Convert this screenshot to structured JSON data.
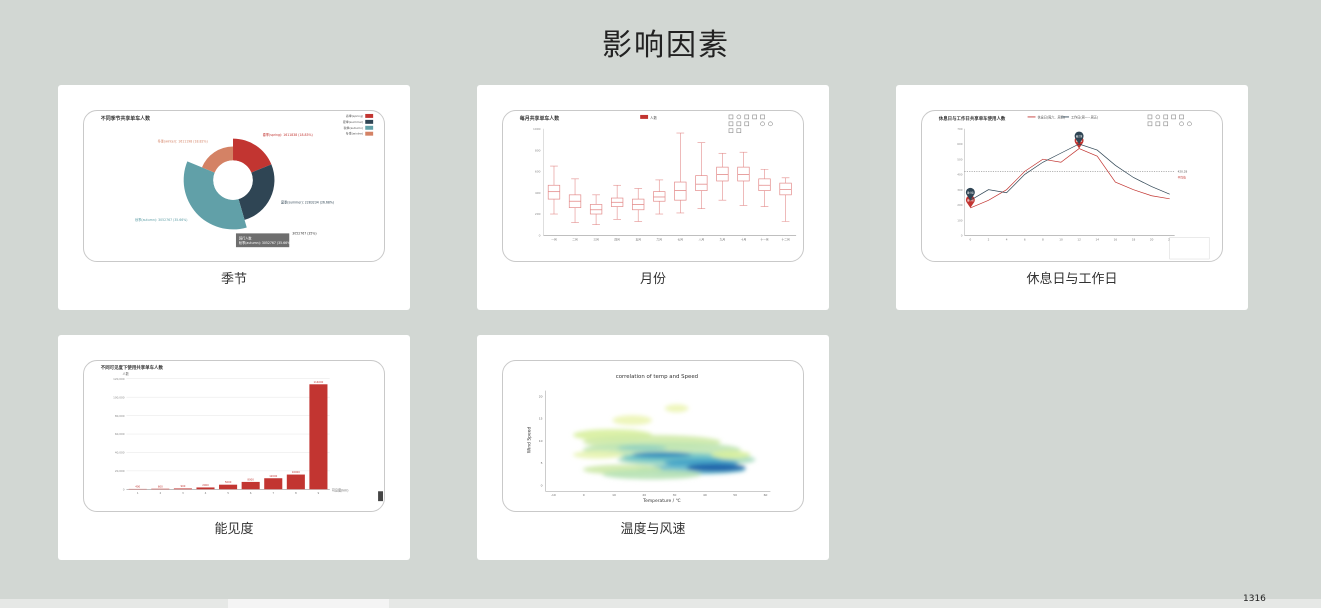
{
  "page": {
    "title": "影响因素"
  },
  "cards": [
    {
      "label": "季节",
      "chart_data": {
        "type": "pie",
        "title": "不同季节共享单车人数",
        "legend": [
          "春季(spring)",
          "夏季(summer)",
          "秋季(autumn)",
          "冬季(winter)"
        ],
        "values": [
          1611838,
          2283234,
          3052767,
          1611198
        ],
        "colors": [
          "#c23531",
          "#2f4554",
          "#61a0a8",
          "#d48265"
        ],
        "slice_labels": [
          "春季(spring): 1611838 (18.83%)",
          "夏季(summer): 2283234 (26.68%)",
          "秋季(autumn): 3052767 (35.66%)",
          "冬季(winter): 1611198 (18.82%)"
        ],
        "tooltip": "秋季(autumn): 3052767 (35.66%)",
        "tooltip_title": "骑行人数",
        "callout": "3052767 (35%)"
      }
    },
    {
      "label": "月份",
      "chart_data": {
        "type": "boxplot",
        "title": "每月共享单车人数",
        "legend": [
          "人数"
        ],
        "categories": [
          "一月",
          "二月",
          "三月",
          "四月",
          "五月",
          "六月",
          "七月",
          "八月",
          "九月",
          "十月",
          "十一月",
          "十二月"
        ],
        "ylim": [
          0,
          1000
        ],
        "box": [
          {
            "min": 200,
            "q1": 340,
            "median": 410,
            "q3": 470,
            "max": 650
          },
          {
            "min": 120,
            "q1": 260,
            "median": 320,
            "q3": 380,
            "max": 530
          },
          {
            "min": 100,
            "q1": 200,
            "median": 240,
            "q3": 290,
            "max": 380
          },
          {
            "min": 150,
            "q1": 270,
            "median": 310,
            "q3": 350,
            "max": 470
          },
          {
            "min": 130,
            "q1": 240,
            "median": 290,
            "q3": 340,
            "max": 440
          },
          {
            "min": 200,
            "q1": 320,
            "median": 360,
            "q3": 410,
            "max": 520
          },
          {
            "min": 210,
            "q1": 330,
            "median": 420,
            "q3": 500,
            "max": 960
          },
          {
            "min": 250,
            "q1": 420,
            "median": 480,
            "q3": 560,
            "max": 870
          },
          {
            "min": 330,
            "q1": 510,
            "median": 570,
            "q3": 640,
            "max": 770
          },
          {
            "min": 280,
            "q1": 510,
            "median": 570,
            "q3": 640,
            "max": 780
          },
          {
            "min": 270,
            "q1": 420,
            "median": 470,
            "q3": 530,
            "max": 620
          },
          {
            "min": 130,
            "q1": 380,
            "median": 430,
            "q3": 490,
            "max": 540
          }
        ]
      }
    },
    {
      "label": "休息日与工作日",
      "chart_data": {
        "type": "line",
        "title": "休息日与工作日共享单车使用人数",
        "legend": [
          "休息日(周六、周日)",
          "工作日(周一~周五)"
        ],
        "categories": [
          "0",
          "2",
          "4",
          "6",
          "8",
          "10",
          "12",
          "14",
          "16",
          "18",
          "20",
          "22"
        ],
        "ylim": [
          0,
          700
        ],
        "series": [
          {
            "name": "休息日(周六、周日)",
            "color": "#c23531",
            "values": [
              180,
              230,
              300,
              420,
              500,
              480,
              570,
              520,
              350,
              300,
              260,
              240
            ]
          },
          {
            "name": "工作日(周一~周五)",
            "color": "#2f4554",
            "values": [
              230,
              300,
              280,
              400,
              480,
              540,
              600,
              560,
              460,
              380,
              320,
              270
            ]
          }
        ],
        "avg_line": 420,
        "avg_labels": [
          "420.28",
          "平均值"
        ],
        "markers": [
          "最大值",
          "最小值",
          "最大值",
          "最小值"
        ]
      }
    },
    {
      "label": "能见度",
      "chart_data": {
        "type": "bar",
        "title": "不同可见度下使用共享单车人数",
        "xlabel": "可见度(km)",
        "ylabel": "人数",
        "categories": [
          "1",
          "2",
          "3",
          "4",
          "5",
          "6",
          "7",
          "8",
          "9"
        ],
        "values": [
          400,
          600,
          900,
          2000,
          5000,
          8000,
          12000,
          16000,
          114000
        ],
        "ylim": [
          0,
          120000
        ],
        "yticks": [
          "0",
          "20,000",
          "40,000",
          "60,000",
          "80,000",
          "100,000",
          "120,000"
        ]
      }
    },
    {
      "label": "温度与风速",
      "chart_data": {
        "type": "heatmap",
        "title": "correlation of temp and Speed",
        "xlabel": "Temperature / ℃",
        "ylabel": "Wind Speed",
        "x_ticks": [
          "-10",
          "0",
          "10",
          "20",
          "30",
          "40",
          "50",
          "60"
        ],
        "y_ticks": [
          "0",
          "5",
          "10",
          "15",
          "20"
        ]
      }
    }
  ],
  "bottom": {
    "text": "1316"
  }
}
